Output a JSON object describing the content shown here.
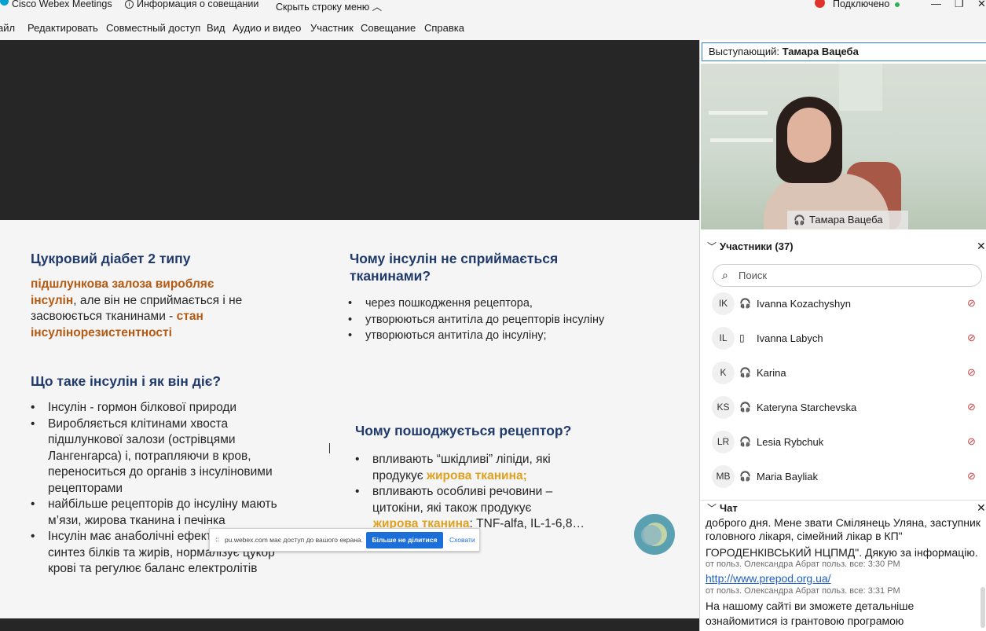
{
  "titlebar": {
    "app_title": "Cisco Webex Meetings",
    "meeting_info": "Информация о совещании",
    "hide_menu": "Скрыть строку меню",
    "connection": "Подключено",
    "info_icon": "info-icon",
    "chevron": "chevron-up-icon"
  },
  "menu": [
    "айл",
    "Редактировать",
    "Совместный доступ",
    "Вид",
    "Аудио и видео",
    "Участник",
    "Совещание",
    "Справка"
  ],
  "slide": {
    "h1": "Цукровий діабет 2 типу",
    "p1_a": "підшлункова залоза виробляє",
    "p1_b": "інсулін",
    "p1_c": ", але він не сприймається і не",
    "p1_d": "засвоюється тканинами - ",
    "p1_e": "стан",
    "p1_f": "інсулінорезистентності",
    "h2": "Що таке інсулін і як він діє?",
    "b2": [
      "Інсулін - гормон білкової природи",
      "Виробляється клітинами хвоста",
      "підшлункової залози (острівцями",
      "Лангенгарса) і, потрапляючи в кров,",
      "переноситься до органів з інсуліновими",
      "рецепторами",
      "найбільше рецепторів до інсуліну мають",
      "м’язи,  жирова тканина і печінка",
      "Інсулін має анаболічні ефекти: стимулює",
      "синтез білків та жирів, нормалізує цукор",
      "крові та регулює баланс електролітів"
    ],
    "h3_a": "Чому інсулін не сприймається",
    "h3_b": "тканинами?",
    "b3": [
      "через пошкодження рецептора,",
      "утворюються антитіла до рецепторів інсуліну",
      "утворюються антитіла до інсуліну;"
    ],
    "h4": "Чому пошоджується рецептор?",
    "b4_1a": "впливають “шкідливі” ліпіди, які",
    "b4_1b": "продукує ",
    "b4_1c": "жирова тканина;",
    "b4_2a": "впливають особливі речовини –",
    "b4_2b": "цитокіни, які також продукує",
    "b4_2c": "жирова тканина",
    "b4_2d": ": TNF-alfa, IL-1-6,8…"
  },
  "share_bar": {
    "message": "pu.webex.com має доступ до вашого екрана.",
    "stop": "Більше не ділитися",
    "hide": "Сховати"
  },
  "panel": {
    "speaker_label": "Выступающий: ",
    "speaker_name": "Тамара Вацеба",
    "video_name": "Тамара Вацеба",
    "participants_title": "Участники (37)",
    "search_placeholder": "Поиск",
    "participants": [
      {
        "initials": "IK",
        "name": "Ivanna Kozachyshyn",
        "device": "headset-icon"
      },
      {
        "initials": "IL",
        "name": "Ivanna Labych",
        "device": "phone-icon"
      },
      {
        "initials": "K",
        "name": "Karina",
        "device": "headset-icon"
      },
      {
        "initials": "KS",
        "name": "Kateryna Starchevska",
        "device": "headset-icon"
      },
      {
        "initials": "LR",
        "name": "Lesia Rybchuk",
        "device": "headset-icon"
      },
      {
        "initials": "MB",
        "name": "Maria Bayliak",
        "device": "headset-icon"
      }
    ],
    "chat_title": "Чат",
    "chat": {
      "l1": "доброго дня. Мене звати Смілянець Уляна, заступник",
      "l2": "головного лікаря, сімейний лікар в КП\"",
      "l3": "ГОРОДЕНКІВСЬКИЙ НЦПМД\". Дякую за інформацію.",
      "m1": "от польз. Олександра Абрат польз. все:   3:30 PM",
      "link": "http://www.prepod.org.ua/",
      "m2": "от польз. Олександра Абрат польз. все:   3:31 PM",
      "l4": "На нашому сайті ви зможете детальніше",
      "l5": "ознайомитися із грантовою програмою"
    }
  }
}
